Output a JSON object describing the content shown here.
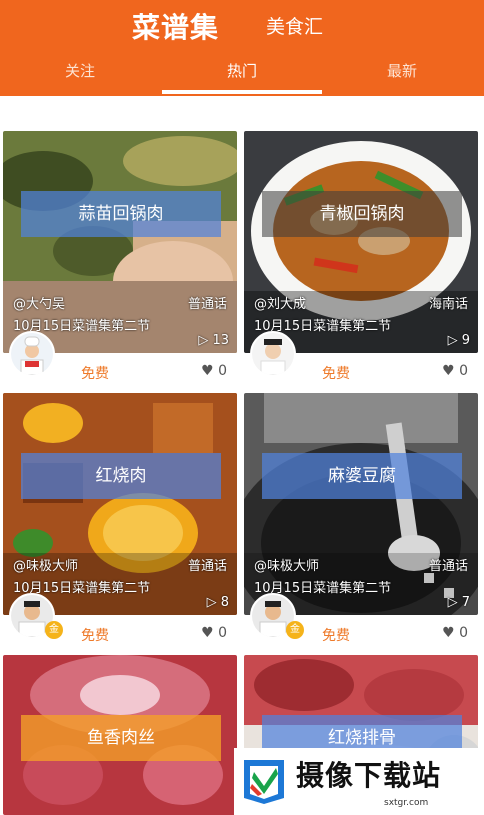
{
  "header": {
    "title": "菜谱集",
    "subtitle": "美食汇"
  },
  "tabs": [
    {
      "label": "关注"
    },
    {
      "label": "热门"
    },
    {
      "label": "最新"
    }
  ],
  "cards": [
    {
      "title": "蒜苗回锅肉",
      "author": "@大勺吴",
      "dialect": "普通话",
      "episode": "10月15日菜谱集第二节",
      "plays": "13",
      "free": "免费",
      "likes": "0"
    },
    {
      "title": "青椒回锅肉",
      "author": "@刘大成",
      "dialect": "海南话",
      "episode": "10月15日菜谱集第二节",
      "plays": "9",
      "free": "免费",
      "likes": "0"
    },
    {
      "title": "红烧肉",
      "author": "@味极大师",
      "dialect": "普通话",
      "episode": "10月15日菜谱集第二节",
      "plays": "8",
      "free": "免费",
      "likes": "0"
    },
    {
      "title": "麻婆豆腐",
      "author": "@味极大师",
      "dialect": "普通话",
      "episode": "10月15日菜谱集第二节",
      "plays": "7",
      "free": "免费",
      "likes": "0"
    },
    {
      "title": "鱼香肉丝"
    },
    {
      "title": "红烧排骨"
    }
  ],
  "watermark": {
    "text": "摄像下载站",
    "url": "sxtgr.com"
  }
}
